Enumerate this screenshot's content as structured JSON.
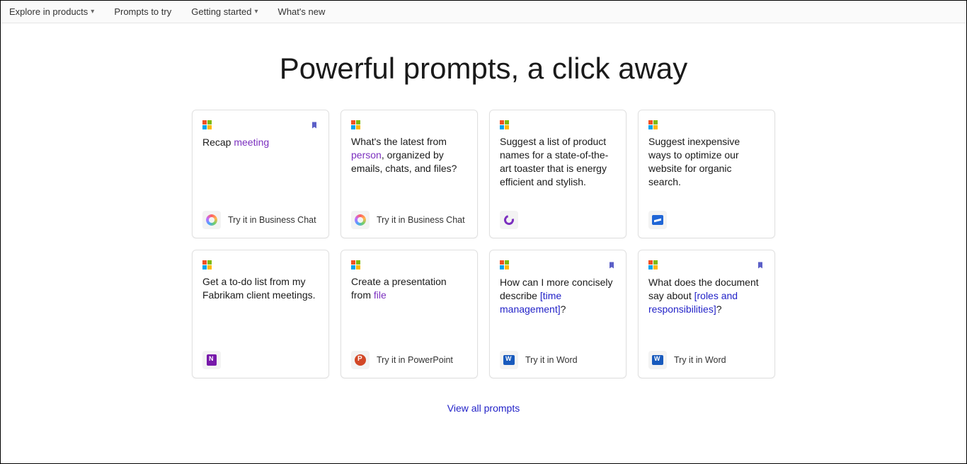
{
  "nav": {
    "explore": "Explore in products",
    "prompts": "Prompts to try",
    "getting_started": "Getting started",
    "whats_new": "What's new"
  },
  "headline": "Powerful prompts, a click away",
  "cards": [
    {
      "bookmarked": true,
      "prompt_pre": "Recap ",
      "prompt_hl": "meeting",
      "prompt_post": "",
      "app_icon": "chat",
      "try_label": "Try it in Business Chat"
    },
    {
      "bookmarked": false,
      "prompt_pre": "What's the latest from ",
      "prompt_hl": "person",
      "prompt_post": ", organized by emails, chats, and files?",
      "app_icon": "chat",
      "try_label": "Try it in Business Chat"
    },
    {
      "bookmarked": false,
      "prompt_pre": "Suggest a list of product names for a state-of-the-art toaster that is energy efficient and stylish.",
      "prompt_hl": "",
      "prompt_post": "",
      "app_icon": "loop",
      "try_label": ""
    },
    {
      "bookmarked": false,
      "prompt_pre": "Suggest inexpensive ways to optimize our website for organic search.",
      "prompt_hl": "",
      "prompt_post": "",
      "app_icon": "whiteboard",
      "try_label": ""
    },
    {
      "bookmarked": false,
      "prompt_pre": "Get a to-do list from my Fabrikam client meetings.",
      "prompt_hl": "",
      "prompt_post": "",
      "app_icon": "onenote",
      "try_label": ""
    },
    {
      "bookmarked": false,
      "prompt_pre": "Create a presentation from ",
      "prompt_hl": "file",
      "prompt_post": "",
      "app_icon": "ppt",
      "try_label": "Try it in PowerPoint"
    },
    {
      "bookmarked": true,
      "prompt_pre": "How can I more concisely describe ",
      "prompt_hl": "[time management]",
      "prompt_post": "?",
      "hl_bracket": true,
      "app_icon": "word",
      "try_label": "Try it in Word"
    },
    {
      "bookmarked": true,
      "prompt_pre": "What does the document say about ",
      "prompt_hl": "[roles and responsibilities]",
      "prompt_post": "?",
      "hl_bracket": true,
      "app_icon": "word",
      "try_label": "Try it in Word"
    }
  ],
  "view_all": "View all prompts"
}
